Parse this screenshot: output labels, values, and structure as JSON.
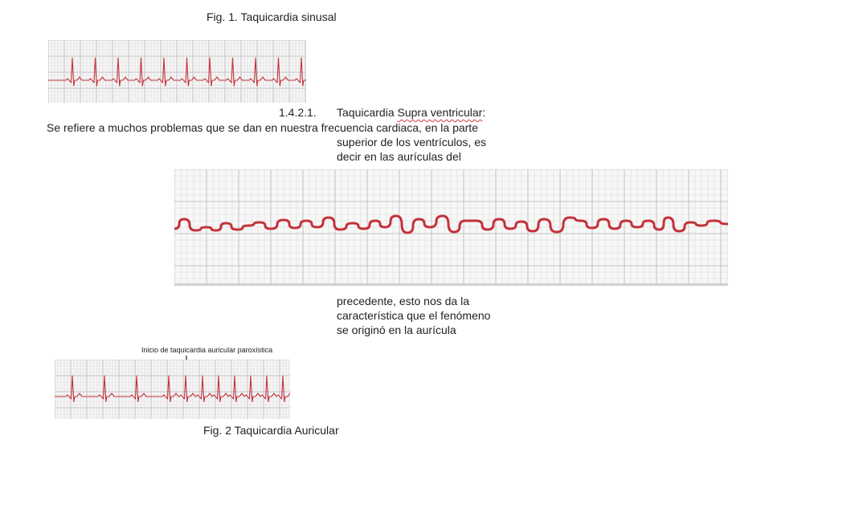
{
  "fig1_caption": "Fig. 1. Taquicardia sinusal",
  "section": {
    "number": "1.4.2.1.",
    "title_prefix": "Taquicardia ",
    "title_underlined": "Supra ventricular",
    "title_suffix": ":"
  },
  "paragraph_lines": [
    "Se refiere a muchos problemas que se dan en nuestra frecuencia cardiaca, en la parte",
    "superior de los ventrículos, es",
    "decir en las aurículas del"
  ],
  "continuation_lines": [
    "precedente, esto nos da la",
    "característica que el fenómeno",
    "se originó en la aurícula"
  ],
  "fig2_annotation": "Inicio de taquicardia auricular paroxística",
  "fig2_caption": "Fig. 2 Taquicardia Auricular",
  "colors": {
    "trace": "#c4323a",
    "grid_minor": "#dcdcdc",
    "grid_major": "#c2c2c2",
    "text": "#222222",
    "spelling_underline": "#d23b3b"
  }
}
